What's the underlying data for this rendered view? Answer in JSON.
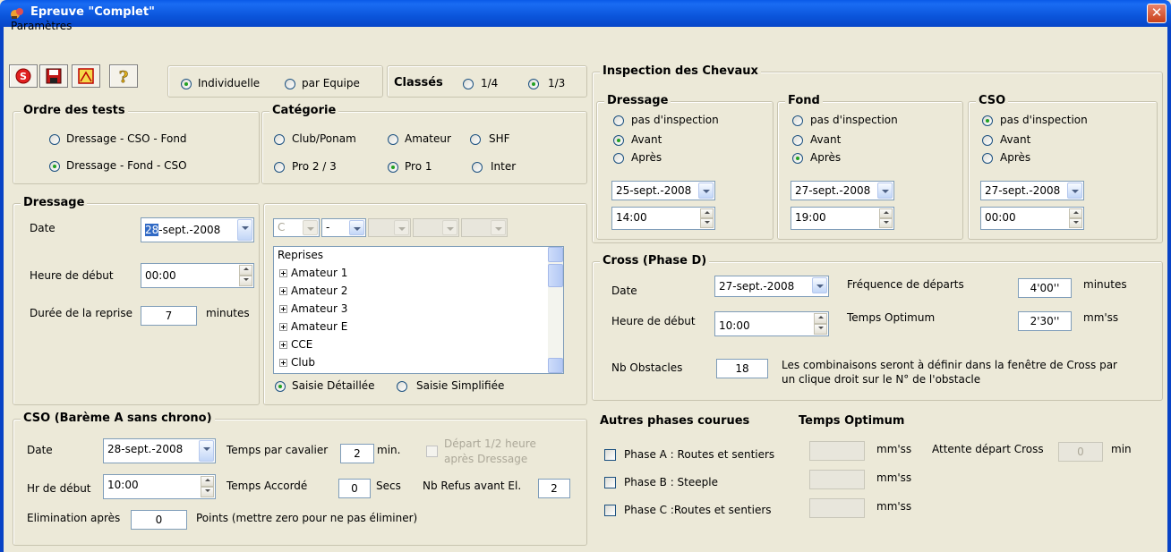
{
  "window": {
    "title": "Epreuve \"Complet\"",
    "close_label": "✕"
  },
  "menu": {
    "parametres": "Paramètres"
  },
  "toolbar": {
    "icons": [
      "stop-icon",
      "save-icon",
      "print-icon",
      "help-icon"
    ]
  },
  "mode": {
    "individuelle": "Individuelle",
    "par_equipe": "par Equipe",
    "classes_label": "Classés",
    "q14": "1/4",
    "q13": "1/3"
  },
  "ordre": {
    "title": "Ordre des tests",
    "opt1": "Dressage - CSO - Fond",
    "opt2": "Dressage - Fond - CSO"
  },
  "categorie": {
    "title": "Catégorie",
    "club": "Club/Ponam",
    "amateur": "Amateur",
    "shf": "SHF",
    "pro23": "Pro 2 / 3",
    "pro1": "Pro 1",
    "inter": "Inter"
  },
  "dressage": {
    "title": "Dressage",
    "date_label": "Date",
    "date_day": "28",
    "date_rest": "-sept.-2008",
    "heure_label": "Heure de début",
    "heure_value": "00:00",
    "duree_label": "Durée de la reprise",
    "duree_value": "7",
    "duree_unit": "minutes",
    "combo1": "C",
    "combo2": "-",
    "reprises_title": "Reprises",
    "reprises": [
      "Amateur 1",
      "Amateur 2",
      "Amateur 3",
      "Amateur E",
      "CCE",
      "Club"
    ],
    "saisie_detaillee": "Saisie Détaillée",
    "saisie_simplifiee": "Saisie Simplifiée"
  },
  "cso": {
    "title": "CSO (Barème A sans chrono)",
    "date_label": "Date",
    "date_value": "28-sept.-2008",
    "temps_cavalier_label": "Temps par cavalier",
    "temps_cavalier_value": "2",
    "temps_cavalier_unit": "min.",
    "depart_label_1": "Départ 1/2 heure",
    "depart_label_2": "après Dressage",
    "hr_label": "Hr de début",
    "hr_value": "10:00",
    "temps_accorde_label": "Temps Accordé",
    "temps_accorde_value": "0",
    "temps_accorde_unit": "Secs",
    "nb_refus_label": "Nb Refus avant El.",
    "nb_refus_value": "2",
    "elimination_label": "Elimination après",
    "elimination_value": "0",
    "elimination_note": "Points (mettre zero pour ne pas éliminer)"
  },
  "inspection": {
    "title": "Inspection des Chevaux",
    "opt_pas": "pas d'inspection",
    "opt_avant": "Avant",
    "opt_apres": "Après",
    "dressage": {
      "title": "Dressage",
      "date": "25-sept.-2008",
      "time": "14:00"
    },
    "fond": {
      "title": "Fond",
      "date": "27-sept.-2008",
      "time": "19:00"
    },
    "cso": {
      "title": "CSO",
      "date": "27-sept.-2008",
      "time": "00:00"
    }
  },
  "cross": {
    "title": "Cross (Phase D)",
    "date_label": "Date",
    "date_value": "27-sept.-2008",
    "freq_label": "Fréquence de départs",
    "freq_value": "4'00''",
    "freq_unit": "minutes",
    "heure_label": "Heure de début",
    "heure_value": "10:00",
    "temps_label": "Temps Optimum",
    "temps_value": "2'30''",
    "temps_unit": "mm'ss",
    "nb_label": "Nb Obstacles",
    "nb_value": "18",
    "note_1": "Les combinaisons seront à définir dans la fenêtre de Cross par",
    "note_2": "un clique droit sur le N° de l'obstacle"
  },
  "autres": {
    "title": "Autres phases courues",
    "temps_title": "Temps Optimum",
    "phase_a": "Phase A : Routes et sentiers",
    "phase_b": "Phase B : Steeple",
    "phase_c": "Phase C :Routes et sentiers",
    "unit": "mm'ss",
    "attente_label": "Attente départ Cross",
    "attente_value": "0",
    "attente_unit": "min"
  }
}
